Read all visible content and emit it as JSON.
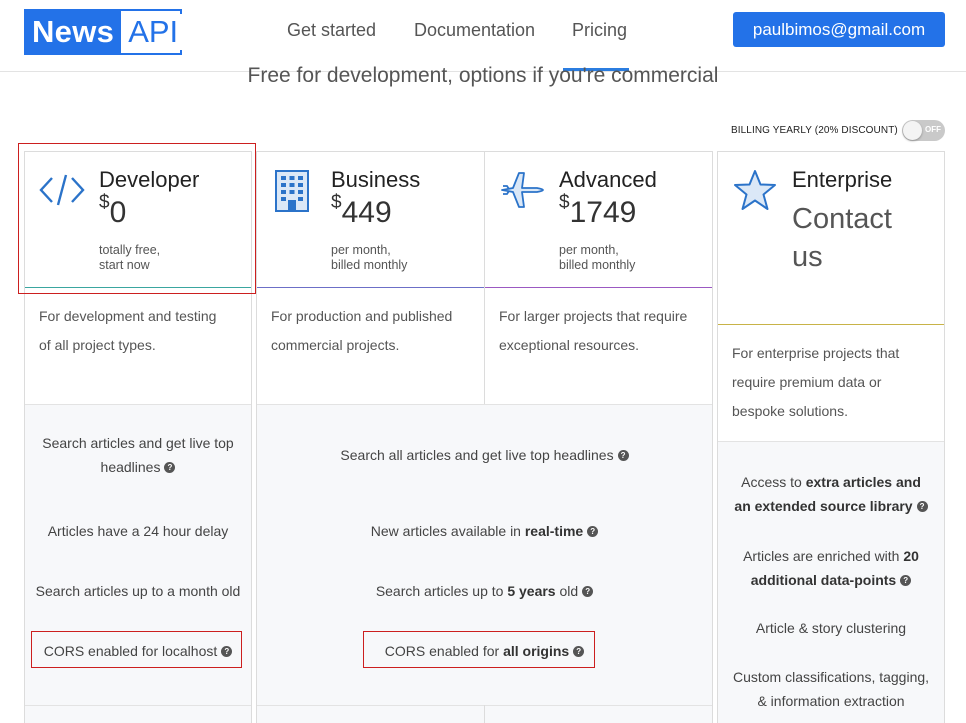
{
  "header": {
    "logo_news": "News",
    "logo_api": "API",
    "nav": [
      "Get started",
      "Documentation",
      "Pricing"
    ],
    "user_email": "paulbimos@gmail.com"
  },
  "subtitle": "Free for development, options if you're commercial",
  "billing": {
    "label": "BILLING YEARLY (20% DISCOUNT)",
    "toggle_state": "OFF"
  },
  "plans": [
    {
      "name": "Developer",
      "currency": "$",
      "price": "0",
      "note1": "totally free,",
      "note2": "start now",
      "desc1": "For development and testing",
      "desc2": "of all project types.",
      "icon": "code-icon"
    },
    {
      "name": "Business",
      "currency": "$",
      "price": "449",
      "note1": "per month,",
      "note2": "billed monthly",
      "desc1": "For production and published",
      "desc2": "commercial projects.",
      "icon": "building-icon"
    },
    {
      "name": "Advanced",
      "currency": "$",
      "price": "1749",
      "note1": "per month,",
      "note2": "billed monthly",
      "desc1": "For larger projects that require",
      "desc2": "exceptional resources.",
      "icon": "airplane-icon"
    },
    {
      "name": "Enterprise",
      "price_line1": "Contact",
      "price_line2": "us",
      "desc1": "For enterprise projects that",
      "desc2": "require premium data or",
      "desc3": "bespoke solutions.",
      "icon": "star-icon"
    }
  ],
  "features": {
    "developer": {
      "f1a": "Search articles and get live top",
      "f1b": "headlines",
      "f2": "Articles have a 24 hour delay",
      "f3": "Search articles up to a month old",
      "f4": "CORS enabled for localhost"
    },
    "business_advanced": {
      "f1": "Search all articles and get live top headlines",
      "f2_pre": "New articles available in ",
      "f2_bold": "real-time",
      "f3_pre": "Search articles up to ",
      "f3_bold": "5 years",
      "f3_post": " old",
      "f4_pre": "CORS enabled for ",
      "f4_bold": "all origins"
    },
    "enterprise": {
      "f1_pre": "Access to ",
      "f1_bold1": "extra articles and",
      "f1_bold2": "an extended source library",
      "f2_pre": "Articles are enriched with ",
      "f2_bold1": "20",
      "f2_bold2": "additional data-points",
      "f3": "Article & story clustering",
      "f4a": "Custom classifications, tagging,",
      "f4b": "& information extraction"
    }
  },
  "colors": {
    "brand": "#2372e8",
    "developer_accent": "#3aa6a0",
    "business_accent": "#6c6fc7",
    "advanced_accent": "#9b59c2",
    "enterprise_accent": "#c8b347",
    "highlight": "#cc1f1f"
  }
}
